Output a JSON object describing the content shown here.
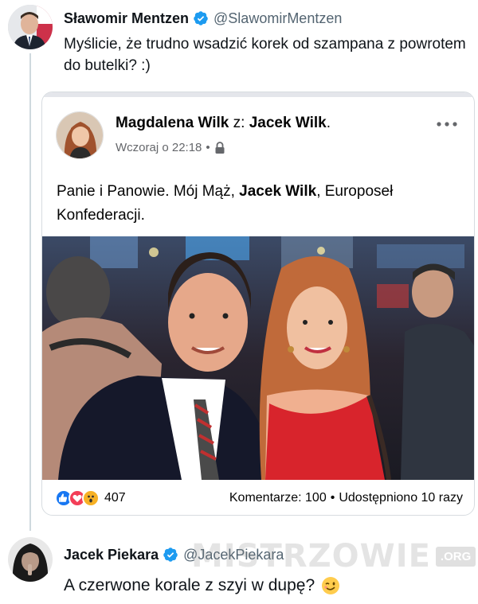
{
  "main_tweet": {
    "author_name": "Sławomir Mentzen",
    "handle": "@SlawomirMentzen",
    "text": "Myślicie, że trudno wsadzić korek od szampana z powrotem do butelki? :)"
  },
  "facebook_post": {
    "author": "Magdalena Wilk",
    "with_label": "z:",
    "tagged": "Jacek Wilk",
    "time": "Wczoraj o 22:18",
    "separator": "•",
    "text_before": "Panie i Panowie. Mój Mąż, ",
    "text_bold": "Jacek Wilk",
    "text_after": ", Europoseł Konfederacji.",
    "reaction_count": "407",
    "comments": "Komentarze: 100",
    "stats_separator": "•",
    "shares": "Udostępniono 10 razy"
  },
  "reply_tweet": {
    "author_name": "Jacek Piekara",
    "handle": "@JacekPiekara",
    "text": "A czerwone korale z szyi w dupę?",
    "emoji": "winking-face"
  },
  "watermark": {
    "main": "MISTRZOWIE",
    "sub": ".ORG"
  },
  "colors": {
    "verified_blue": "#1d9bf0",
    "fb_like_blue": "#1877f2",
    "fb_love_red": "#f33e58",
    "fb_wow_yellow": "#f7b125"
  }
}
